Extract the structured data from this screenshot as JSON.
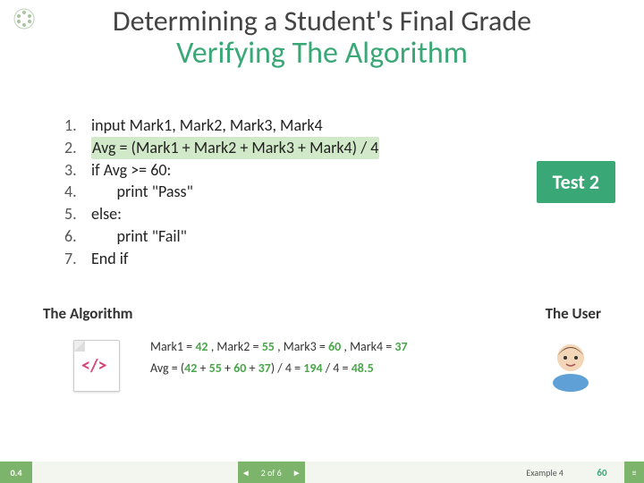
{
  "title": {
    "line1": "Determining a Student's Final Grade",
    "line2": "Verifying The Algorithm"
  },
  "algorithm": {
    "lines": [
      {
        "n": "1.",
        "text": "input Mark1, Mark2, Mark3, Mark4"
      },
      {
        "n": "2.",
        "text": "Avg = (Mark1 + Mark2 + Mark3 + Mark4) / 4"
      },
      {
        "n": "3.",
        "text": "if Avg >= 60:"
      },
      {
        "n": "4.",
        "text": "       print \"Pass\""
      },
      {
        "n": "5.",
        "text": "else:"
      },
      {
        "n": "6.",
        "text": "       print \"Fail\""
      },
      {
        "n": "7.",
        "text": "End if"
      }
    ],
    "highlight_index": 1
  },
  "test_badge": "Test 2",
  "labels": {
    "algorithm": "The Algorithm",
    "user": "The User"
  },
  "trace": {
    "input": {
      "m1_label": "Mark1 =",
      "m1": "42",
      "m2_label": ", Mark2 =",
      "m2": "55",
      "m3_label": ", Mark3 =",
      "m3": "60",
      "m4_label": ", Mark4 =",
      "m4": "37"
    },
    "avg": {
      "pre": "Avg = (",
      "a": "42",
      "plus1": " + ",
      "b": "55",
      "plus2": " + ",
      "c": "60",
      "plus3": " + ",
      "d": "37",
      "mid1": ") / 4 = ",
      "sum": "194",
      "mid2": " / 4 = ",
      "res": "48.5"
    }
  },
  "footer": {
    "version": "0.4",
    "prev": "◄",
    "position": "2 of 6",
    "next": "►",
    "example": "Example 4",
    "page": "60",
    "menu": "≡"
  },
  "chart_data": {
    "type": "table",
    "title": "Test 2 input marks and computed average",
    "categories": [
      "Mark1",
      "Mark2",
      "Mark3",
      "Mark4",
      "Avg"
    ],
    "values": [
      42,
      55,
      60,
      37,
      48.5
    ]
  }
}
